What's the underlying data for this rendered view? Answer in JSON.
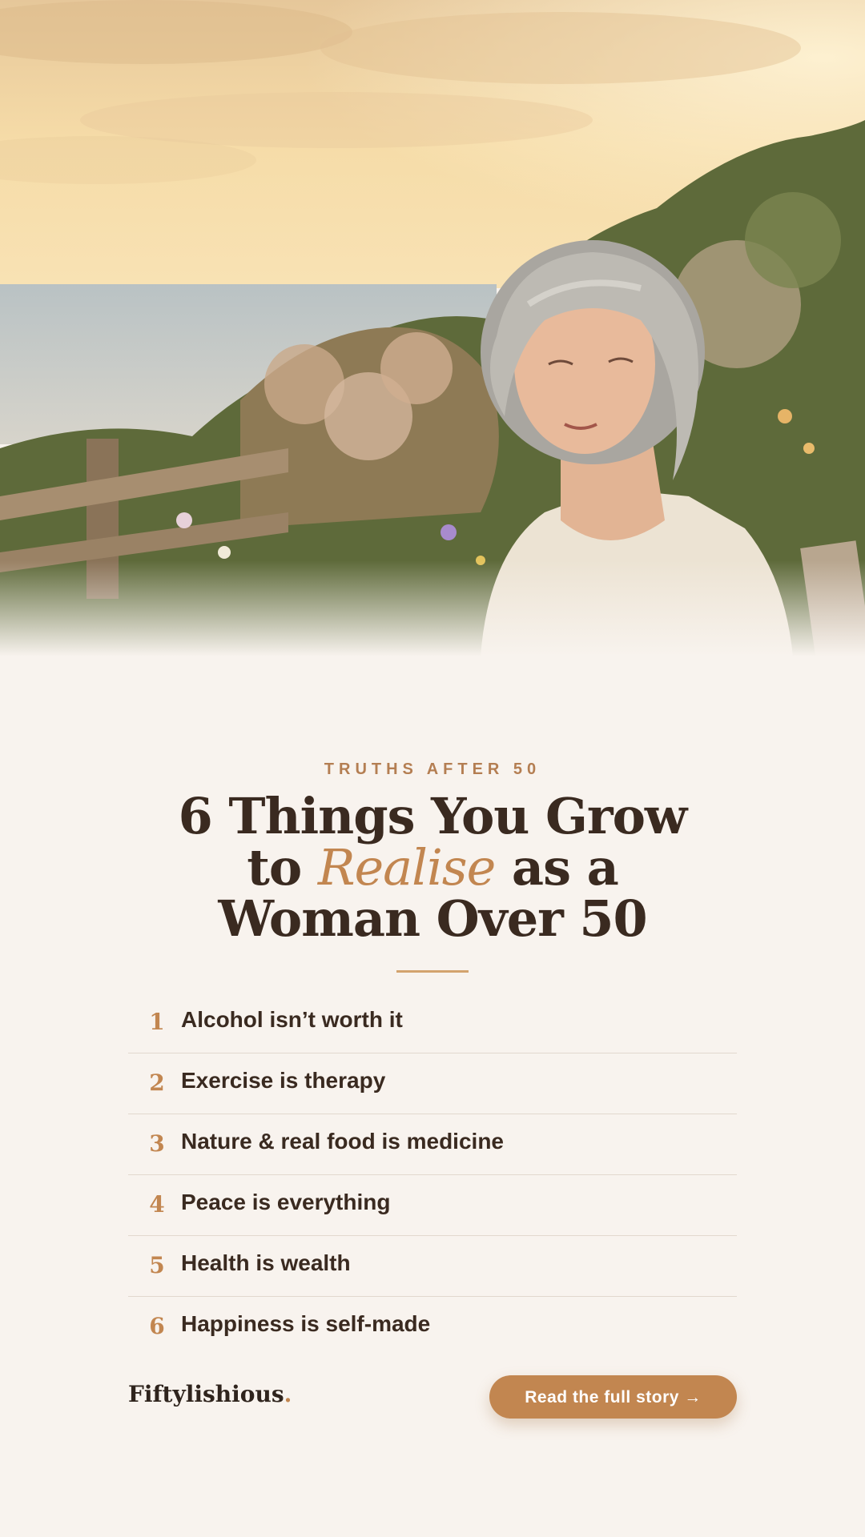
{
  "hero": {
    "image_label": "woman-over-50-at-coastal-garden-sunset"
  },
  "header": {
    "eyebrow": "TRUTHS AFTER 50",
    "title_line1": "6 Things You Grow",
    "title_to": "to",
    "title_accent": "Realise",
    "title_rest": "as a",
    "title_line3": "Woman Over 50"
  },
  "list": {
    "items": [
      {
        "num": "1",
        "text": "Alcohol isn’t worth it"
      },
      {
        "num": "2",
        "text": "Exercise is therapy"
      },
      {
        "num": "3",
        "text": "Nature & real food is medicine"
      },
      {
        "num": "4",
        "text": "Peace is everything"
      },
      {
        "num": "5",
        "text": "Health is wealth"
      },
      {
        "num": "6",
        "text": "Happiness is self-made"
      }
    ]
  },
  "footer": {
    "brand": "Fiftylishious",
    "brand_dot": ".",
    "cta_label": "Read the full story →"
  },
  "colors": {
    "background": "#f8f3ee",
    "accent": "#c28650",
    "text": "#3a2a20"
  }
}
